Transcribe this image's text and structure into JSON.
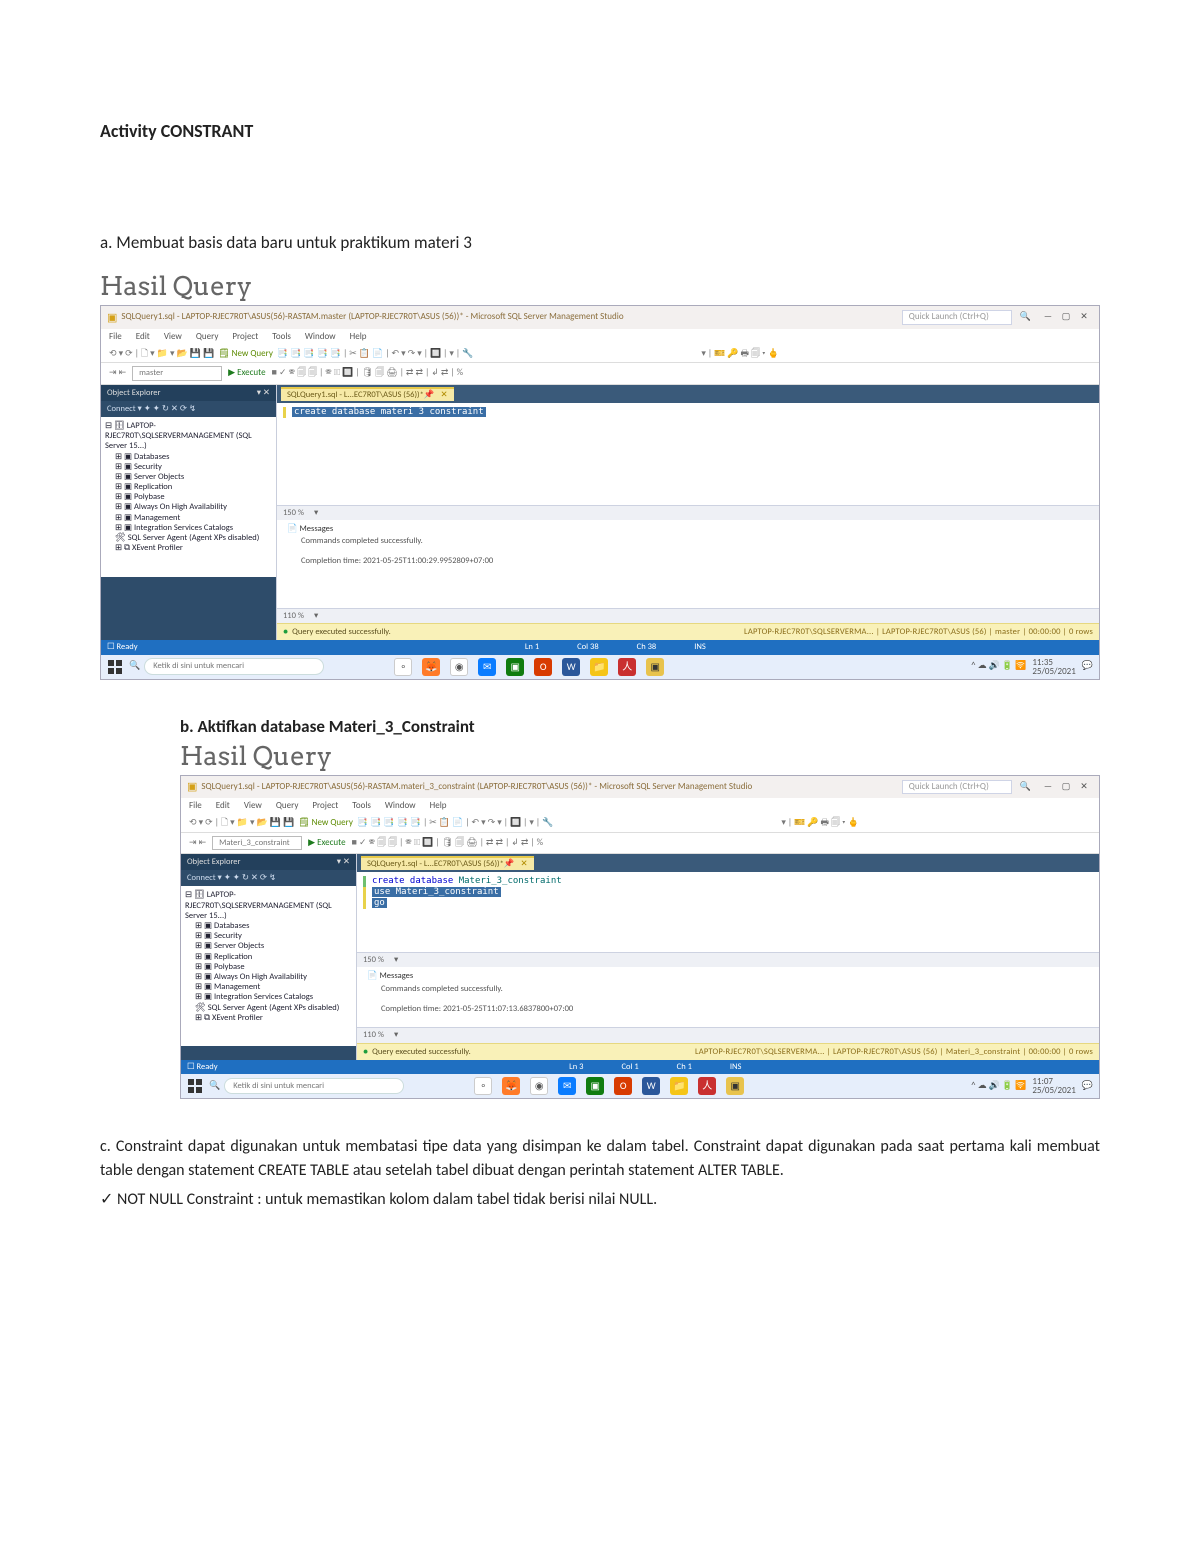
{
  "doc": {
    "title": "Activity CONSTRANT",
    "a_heading": "a. Membuat basis data baru untuk praktikum materi 3",
    "hasil": "Hasil Query",
    "b_heading": "b. Aktifkan database Materi_3_Constraint",
    "c_text": "c. Constraint dapat digunakan untuk membatasi tipe data yang disimpan ke dalam tabel. Constraint dapat digunakan pada saat pertama kali membuat table dengan statement CREATE TABLE atau setelah tabel dibuat dengan perintah statement ALTER TABLE.",
    "check": "✓ NOT NULL Constraint : untuk memastikan kolom dalam tabel tidak berisi nilai NULL."
  },
  "ssms_a": {
    "title": "SQLQuery1.sql - LAPTOP-RJEC7R0T\\ASUS(56)-RASTAM.master (LAPTOP-RJEC7R0T\\ASUS (56))* - Microsoft SQL Server Management Studio",
    "quick_launch": "Quick Launch (Ctrl+Q)",
    "menu": [
      "File",
      "Edit",
      "View",
      "Query",
      "Project",
      "Tools",
      "Window",
      "Help"
    ],
    "new_query": " New Query ",
    "toolbar2_db": "master",
    "toolbar2_exec": "▶ Execute",
    "sidebar_title": "Object Explorer",
    "sidebar_title_close": "▾ ✕",
    "connect": "Connect ▾  ✦ ✦  ↻  ✕  ⟳  ↯",
    "tree_root": "⊟ 🗄 LAPTOP-RJEC7R0T\\SQLSERVERMANAGEMENT (SQL Server 15...)",
    "tree_items": [
      "⊞ ▣ Databases",
      "⊞ ▣ Security",
      "⊞ ▣ Server Objects",
      "⊞ ▣ Replication",
      "⊞ ▣ Polybase",
      "⊞ ▣ Always On High Availability",
      "⊞ ▣ Management",
      "⊞ ▣ Integration Services Catalogs",
      "  🛠 SQL Server Agent (Agent XPs disabled)",
      "⊞ ⧉ XEvent Profiler"
    ],
    "tab": "SQLQuery1.sql - L...EC7R0T\\ASUS (56))*",
    "editor_sel": "create database materi 3 constraint",
    "divbar_pct": "150 %",
    "msgtab": "📄 Messages",
    "msg1": "Commands completed successfully.",
    "msg2": "Completion time: 2021-05-25T11:00:29.9952809+07:00",
    "divbar_pct2": "110 %",
    "statusq": "Query executed successfully.",
    "statusq_r": "LAPTOP-RJEC7R0T\\SQLSERVERMA... | LAPTOP-RJEC7R0T\\ASUS (56) | master | 00:00:00 | 0 rows",
    "bluestatus_ready": "☐ Ready",
    "bluestatus_labels": [
      "Ln 1",
      "Col 38",
      "Ch 38",
      "INS"
    ],
    "taskbar_search": "Ketik di sini untuk mencari",
    "taskbar_datetime1": "11:35",
    "taskbar_datetime2": "25/05/2021"
  },
  "ssms_b": {
    "title": "SQLQuery1.sql - LAPTOP-RJEC7R0T\\ASUS(56)-RASTAM.materi_3_constraint (LAPTOP-RJEC7R0T\\ASUS (56))* - Microsoft SQL Server Management Studio",
    "quick_launch": "Quick Launch (Ctrl+Q)",
    "menu": [
      "File",
      "Edit",
      "View",
      "Query",
      "Project",
      "Tools",
      "Window",
      "Help"
    ],
    "toolbar2_db": "Materi_3_constraint",
    "tab": "SQLQuery1.sql - L...EC7R0T\\ASUS (56))*",
    "editor_line1_kw": "create database",
    "editor_line1_rest": " Materi_3_constraint",
    "editor_line2_kw": "use",
    "editor_line2_rest": " Materi_3_constraint",
    "editor_line3": "go",
    "tree_root": "⊟ 🗄 LAPTOP-RJEC7R0T\\SQLSERVERMANAGEMENT (SQL Server 15...)",
    "tree_items": [
      "⊞ ▣ Databases",
      "⊞ ▣ Security",
      "⊞ ▣ Server Objects",
      "⊞ ▣ Replication",
      "⊞ ▣ Polybase",
      "⊞ ▣ Always On High Availability",
      "⊞ ▣ Management",
      "⊞ ▣ Integration Services Catalogs",
      "  🛠 SQL Server Agent (Agent XPs disabled)",
      "⊞ ⧉ XEvent Profiler"
    ],
    "msg1": "Commands completed successfully.",
    "msg2": "Completion time: 2021-05-25T11:07:13.6837800+07:00",
    "divbar_pct": "150 %",
    "divbar_pct2": "110 %",
    "statusq": "Query executed successfully.",
    "statusq_r": "LAPTOP-RJEC7R0T\\SQLSERVERMA... | LAPTOP-RJEC7R0T\\ASUS (56) | Materi_3_constraint | 00:00:00 | 0 rows",
    "bluestatus_ready": "☐ Ready",
    "bluestatus_labels": [
      "Ln 3",
      "Col 1",
      "Ch 1",
      "INS"
    ],
    "taskbar_search": "Ketik di sini untuk mencari",
    "taskbar_datetime1": "11:07",
    "taskbar_datetime2": "25/05/2021"
  }
}
